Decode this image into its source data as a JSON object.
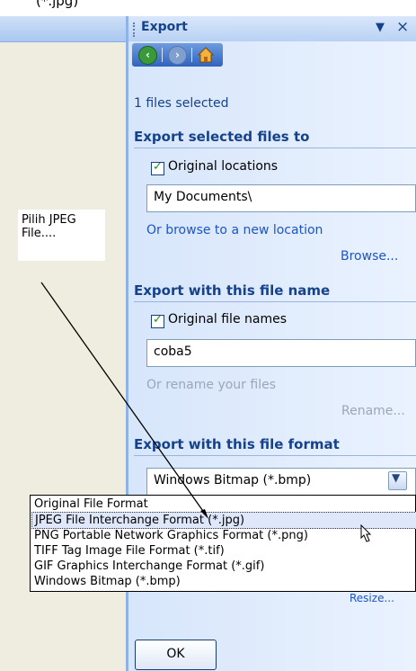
{
  "heading_fragment": "(*.jpg)",
  "pane": {
    "title": "Export",
    "menu_icon": "dropdown-triangle",
    "close_icon": "close-x",
    "nav": {
      "back": "back-arrow-icon",
      "forward": "forward-arrow-icon",
      "home": "home-icon"
    }
  },
  "selection_count": "1 files selected",
  "export_to": {
    "heading": "Export selected files to",
    "checkbox_label": "Original locations",
    "checked": true,
    "location_value": "My Documents\\",
    "browse_hint": "Or browse to a new location",
    "browse_link": "Browse..."
  },
  "file_name": {
    "heading": "Export with this file name",
    "checkbox_label": "Original file names",
    "checked": true,
    "name_value": "coba5",
    "rename_hint": "Or rename your files",
    "rename_link": "Rename..."
  },
  "file_format": {
    "heading": "Export with this file format",
    "selected": "Windows Bitmap (*.bmp)",
    "options": [
      "Original File Format",
      "JPEG File Interchange Format (*.jpg)",
      "PNG Portable Network Graphics Format (*.png)",
      "TIFF Tag Image File Format (*.tif)",
      "GIF Graphics Interchange Format (*.gif)",
      "Windows Bitmap (*.bmp)"
    ],
    "highlighted_index": 1
  },
  "obscured_link": "Resize...",
  "ok_label": "OK",
  "callout": "Pilih JPEG File....",
  "colors": {
    "pane_title": "#15428b",
    "link": "#1c55c6",
    "left_panel": "#efeddf"
  }
}
